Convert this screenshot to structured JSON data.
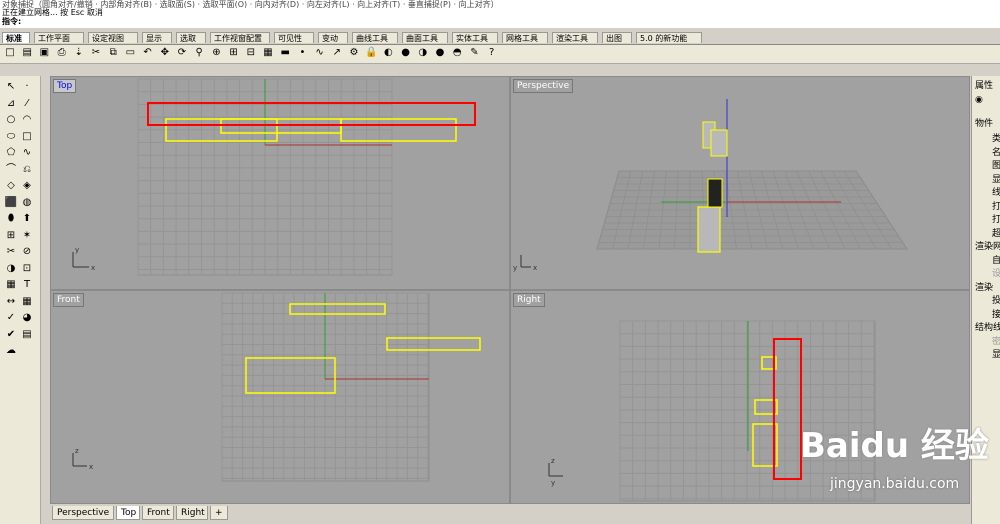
{
  "command_area": {
    "history_line": "对象捕捉（圆角对齐/撤销 · 内部角对齐(B) · 选取面(S) · 选取平面(O) · 向内对齐(D) · 向左对齐(L) · 向上对齐(T) · 垂直捕捉(P) · 向上对齐）",
    "status_line": "正在建立网格... 按 Esc 取消",
    "prompt_label": "指令:"
  },
  "ribbon_tabs": [
    {
      "label": "标准",
      "active": true
    },
    {
      "label": "工作平面"
    },
    {
      "label": "设定视图"
    },
    {
      "label": "显示"
    },
    {
      "label": "选取"
    },
    {
      "label": "工作视窗配置"
    },
    {
      "label": "可见性"
    },
    {
      "label": "变动"
    },
    {
      "label": "曲线工具"
    },
    {
      "label": "曲面工具"
    },
    {
      "label": "实体工具"
    },
    {
      "label": "网格工具"
    },
    {
      "label": "渲染工具"
    },
    {
      "label": "出图"
    },
    {
      "label": "5.0 的新功能"
    }
  ],
  "toolbar_icons": [
    "new-icon",
    "open-icon",
    "save-icon",
    "print-icon",
    "import-icon",
    "cut-icon",
    "copy-icon",
    "paste-icon",
    "undo-icon",
    "pan-icon",
    "rotate-view-icon",
    "zoom-icon",
    "zoom-window-icon",
    "zoom-extents-icon",
    "zoom-selected-icon",
    "viewports-icon",
    "car-icon",
    "point-icon",
    "curve-icon",
    "select-icon",
    "light-icon",
    "lock-icon",
    "color-icon",
    "render-icon",
    "material-icon",
    "sphere-icon",
    "teapot-icon",
    "options-icon",
    "help-icon"
  ],
  "left_tools": [
    "select-arrow-icon",
    "point-icon",
    "polyline-icon",
    "line-icon",
    "circle-icon",
    "arc-icon",
    "ellipse-icon",
    "rectangle-icon",
    "polygon-icon",
    "curve-icon",
    "fillet-icon",
    "offset-icon",
    "surface-icon",
    "patch-icon",
    "box-icon",
    "sphere-icon",
    "cylinder-icon",
    "extrude-icon",
    "join-icon",
    "explode-icon",
    "trim-icon",
    "split-icon",
    "boolean-icon",
    "group-icon",
    "mesh-icon",
    "text-icon",
    "dimension-icon",
    "grid-icon",
    "analyze-icon",
    "render-icon",
    "check-icon",
    "layer-icon",
    "cloud-icon"
  ],
  "viewports": {
    "top": {
      "title": "Top"
    },
    "perspective": {
      "title": "Perspective"
    },
    "front": {
      "title": "Front"
    },
    "right": {
      "title": "Right"
    }
  },
  "axis_labels": {
    "x": "x",
    "y": "y",
    "z": "z"
  },
  "bottom_tabs": [
    {
      "label": "Perspective"
    },
    {
      "label": "Top",
      "active": true
    },
    {
      "label": "Front"
    },
    {
      "label": "Right"
    },
    {
      "label": "+"
    }
  ],
  "properties_panel": {
    "title": "属性",
    "section_object": "物件",
    "rows": [
      "类",
      "名",
      "图",
      "显",
      "线",
      "打",
      "打",
      "超"
    ],
    "section_render": "渲染网",
    "render_rows": [
      "自",
      "设"
    ],
    "section_render2": "渲染",
    "render2_rows": [
      "投",
      "接"
    ],
    "section_struct": "结构线",
    "struct_rows": [
      "密",
      "显"
    ]
  },
  "watermark": {
    "logo": "Baidu 经验",
    "url": "jingyan.baidu.com"
  },
  "colors": {
    "grid_bg": "#a1a1a1",
    "grid_line": "#8e8e8e",
    "x_axis": "#a83232",
    "y_axis": "#2e9e2e",
    "z_axis": "#3232c8",
    "selected_outline": "#ffff00",
    "highlight": "#ff0000"
  }
}
